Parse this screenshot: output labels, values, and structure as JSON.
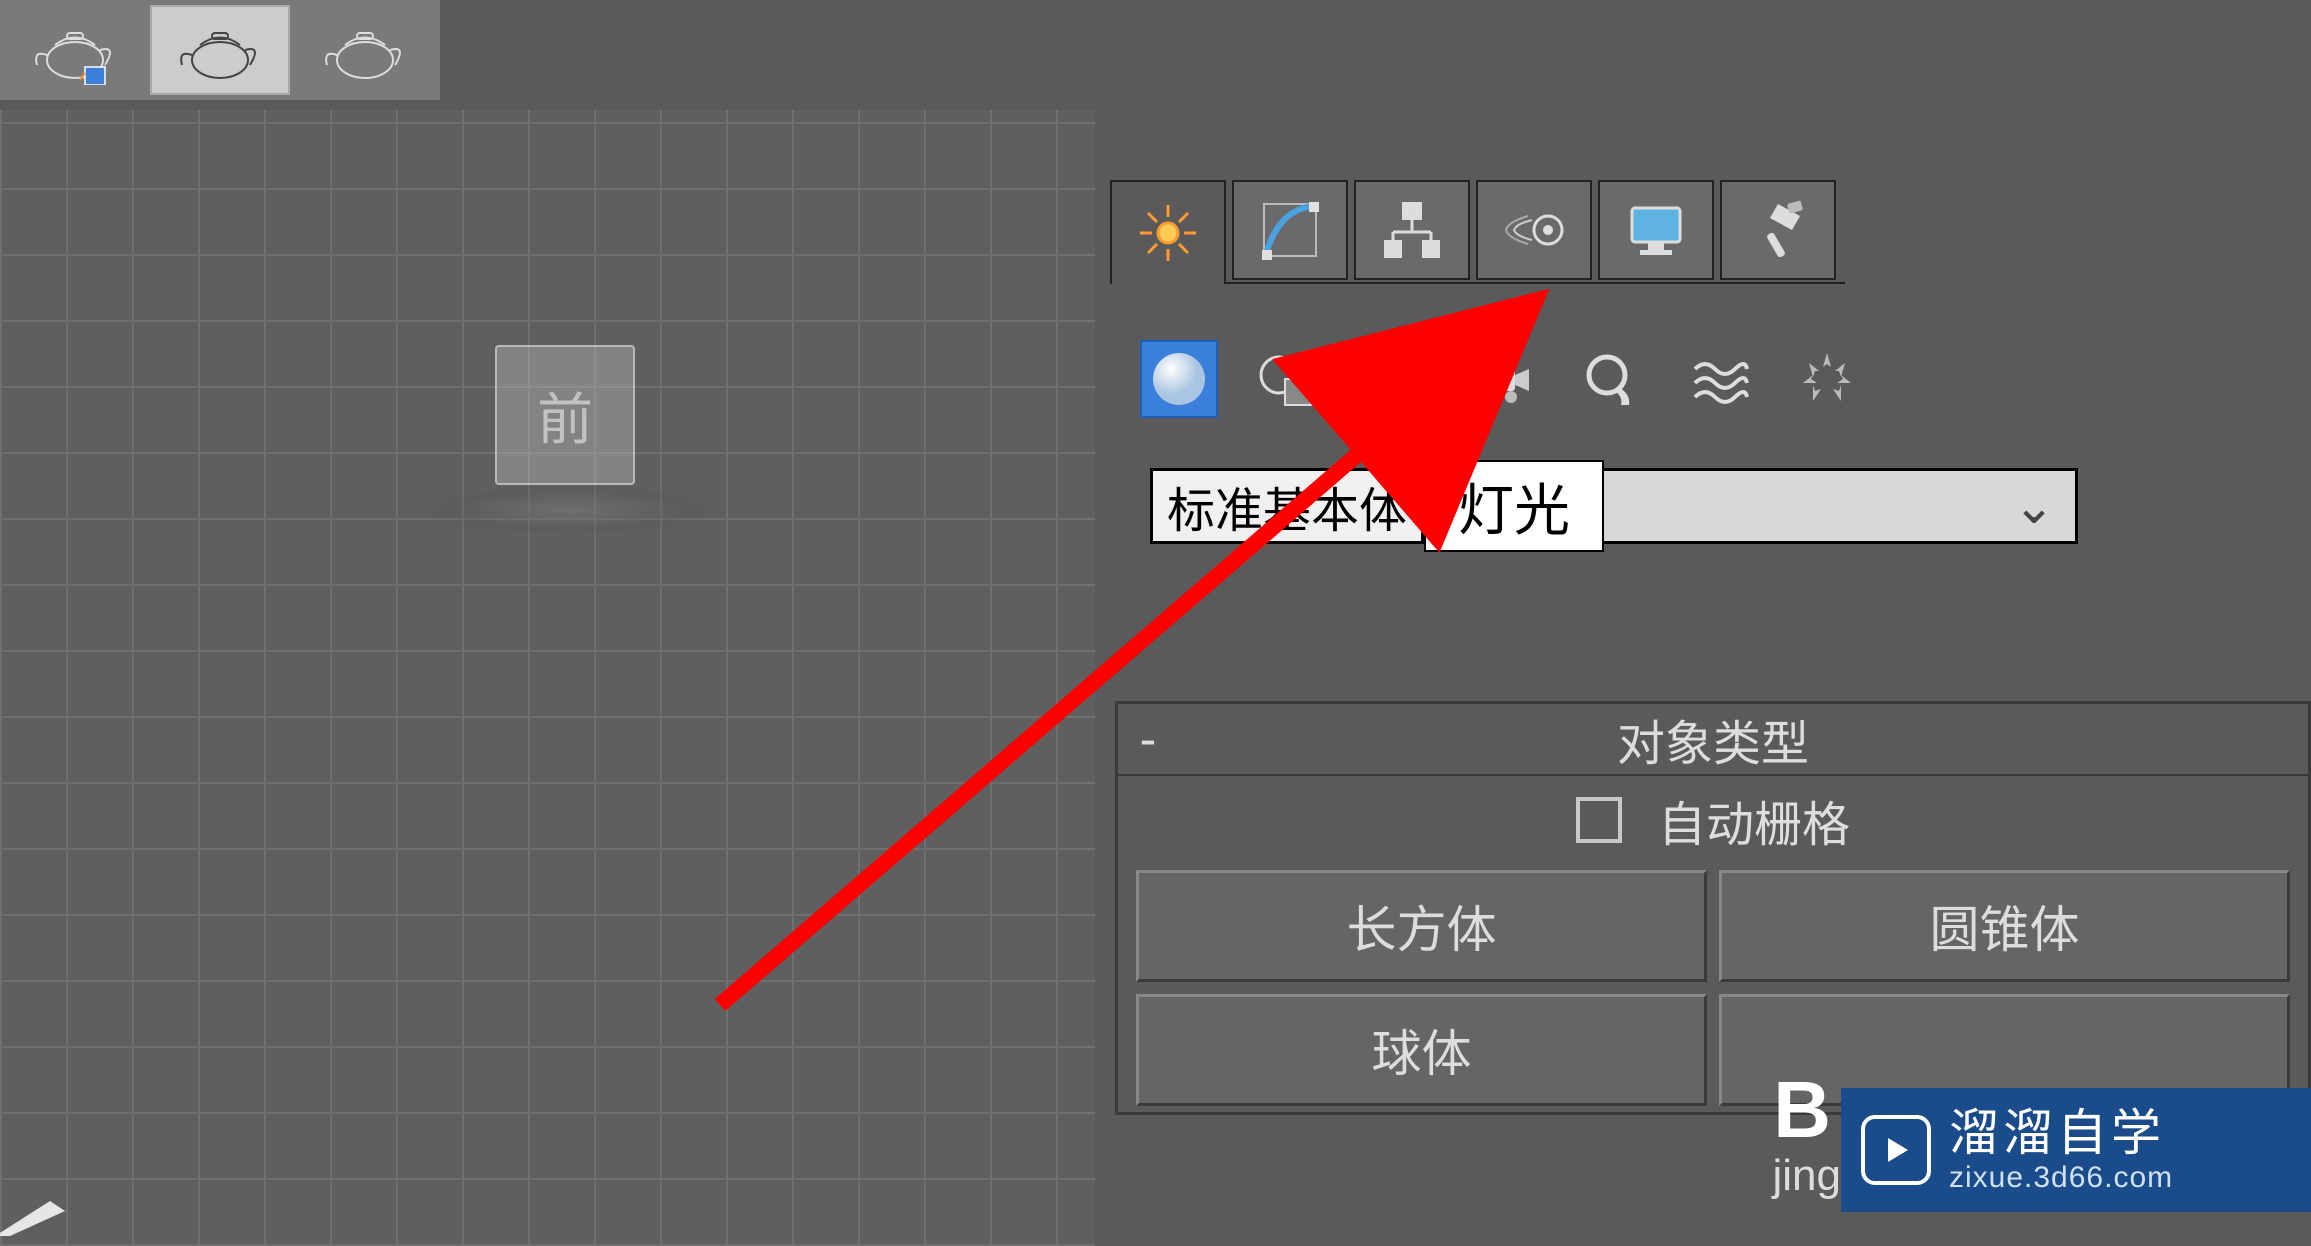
{
  "viewport": {
    "cube_label": "前"
  },
  "tooltip": "灯光",
  "dropdown_label": "标准基本体",
  "panel": {
    "title": "对象类型",
    "collapse": "-",
    "autogrid": "自动栅格"
  },
  "types": {
    "box": "长方体",
    "cone": "圆锥体",
    "sphere": "球体"
  },
  "watermark": {
    "b_letter": "B",
    "jing": "jing",
    "main": "溜溜自学",
    "sub": "zixue.3d66.com"
  }
}
